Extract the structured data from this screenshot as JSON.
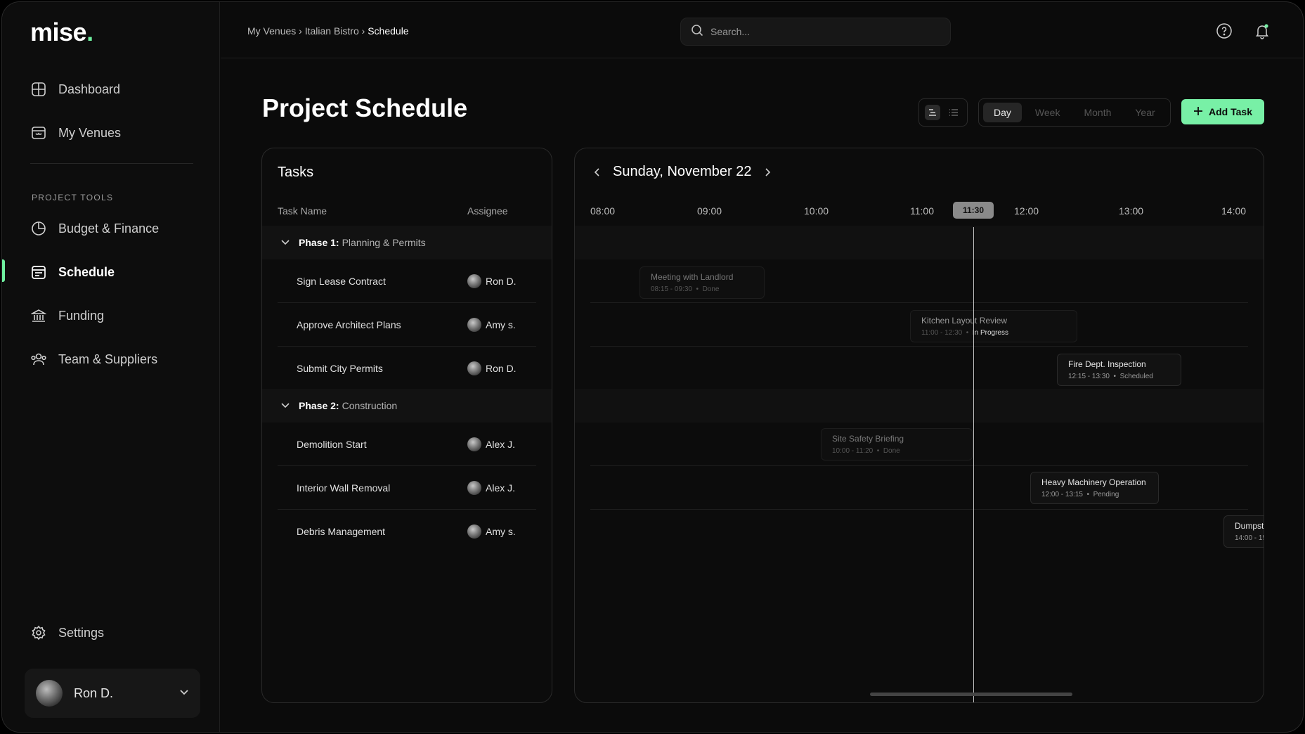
{
  "app": {
    "logo": "mise",
    "logo_dot": ".",
    "accent": "#78f0a6"
  },
  "sidebar": {
    "items": [
      {
        "label": "Dashboard",
        "icon": "grid-icon"
      },
      {
        "label": "My Venues",
        "icon": "storefront-icon"
      }
    ],
    "section_label": "PROJECT TOOLS",
    "tools": [
      {
        "label": "Budget & Finance",
        "icon": "pie-chart-icon"
      },
      {
        "label": "Schedule",
        "icon": "calendar-icon",
        "active": true
      },
      {
        "label": "Funding",
        "icon": "bank-icon"
      },
      {
        "label": "Team & Suppliers",
        "icon": "team-icon"
      }
    ],
    "settings_label": "Settings",
    "user": {
      "name": "Ron D."
    }
  },
  "topbar": {
    "breadcrumb": {
      "a": "My Venues",
      "sep": "›",
      "b": "Italian Bistro",
      "current": "Schedule"
    },
    "search_placeholder": "Search..."
  },
  "header": {
    "title_light": "Project",
    "title_bold": "Schedule",
    "ranges": [
      "Day",
      "Week",
      "Month",
      "Year"
    ],
    "active_range": "Day",
    "add_label": "Add Task"
  },
  "tasks": {
    "title": "Tasks",
    "col_name": "Task Name",
    "col_assignee": "Assignee",
    "phases": [
      {
        "prefix": "Phase 1:",
        "name": "Planning & Permits",
        "rows": [
          {
            "name": "Sign Lease Contract",
            "assignee": "Ron D."
          },
          {
            "name": "Approve Architect Plans",
            "assignee": "Amy s."
          },
          {
            "name": "Submit City Permits",
            "assignee": "Ron D."
          }
        ]
      },
      {
        "prefix": "Phase 2:",
        "name": "Construction",
        "rows": [
          {
            "name": "Demolition Start",
            "assignee": "Alex J."
          },
          {
            "name": "Interior Wall Removal",
            "assignee": "Alex J."
          },
          {
            "name": "Debris Management",
            "assignee": "Amy s."
          }
        ]
      }
    ]
  },
  "timeline": {
    "date": "Sunday, November 22",
    "hours": [
      "08:00",
      "09:00",
      "10:00",
      "11:00",
      "12:00",
      "13:00",
      "14:00"
    ],
    "now": "11:30",
    "events": [
      {
        "title": "Meeting with Landlord",
        "time": "08:15 - 09:30",
        "status": "Done"
      },
      {
        "title": "Kitchen Layout Review",
        "time": "11:00 - 12:30",
        "status": "In Progress"
      },
      {
        "title": "Fire Dept. Inspection",
        "time": "12:15 - 13:30",
        "status": "Scheduled"
      },
      {
        "title": "Site Safety Briefing",
        "time": "10:00 - 11:20",
        "status": "Done"
      },
      {
        "title": "Heavy Machinery Operation",
        "time": "12:00 - 13:15",
        "status": "Pending"
      },
      {
        "title": "Dumpst",
        "time": "14:00 - 15",
        "status": ""
      }
    ]
  }
}
